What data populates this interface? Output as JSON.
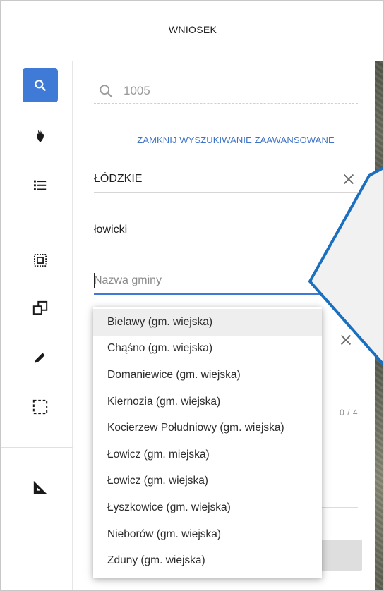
{
  "window": {
    "title": "WNIOSEK"
  },
  "rail": {
    "items": [
      {
        "id": "search",
        "icon": "search-icon",
        "active": true
      },
      {
        "id": "crops",
        "icon": "beet-icon"
      },
      {
        "id": "list",
        "icon": "list-icon"
      },
      {
        "id": "select-region",
        "icon": "select-region-icon"
      },
      {
        "id": "copy",
        "icon": "copy-shape-icon"
      },
      {
        "id": "edit",
        "icon": "pencil-icon"
      },
      {
        "id": "rect-select",
        "icon": "rect-select-icon"
      },
      {
        "id": "measure",
        "icon": "ruler-triangle-icon"
      }
    ],
    "accent": "#3f7bd6"
  },
  "search": {
    "value": "1005"
  },
  "advanced": {
    "toggle_label": "ZAMKNIJ WYSZUKIWANIE ZAAWANSOWANE",
    "voivodeship": "ŁÓDZKIE",
    "county": "łowicki",
    "commune_placeholder": "Nazwa gminy",
    "counter": "0 / 4"
  },
  "commune_options": [
    "Bielawy (gm. wiejska)",
    "Chąśno (gm. wiejska)",
    "Domaniewice (gm. wiejska)",
    "Kiernozia (gm. wiejska)",
    "Kocierzew Południowy (gm. wiejska)",
    "Łowicz (gm. miejska)",
    "Łowicz (gm. wiejska)",
    "Łyszkowice (gm. wiejska)",
    "Nieborów (gm. wiejska)",
    "Zduny (gm. wiejska)"
  ],
  "highlighted_option": "Bielawy (gm. wiejska)"
}
